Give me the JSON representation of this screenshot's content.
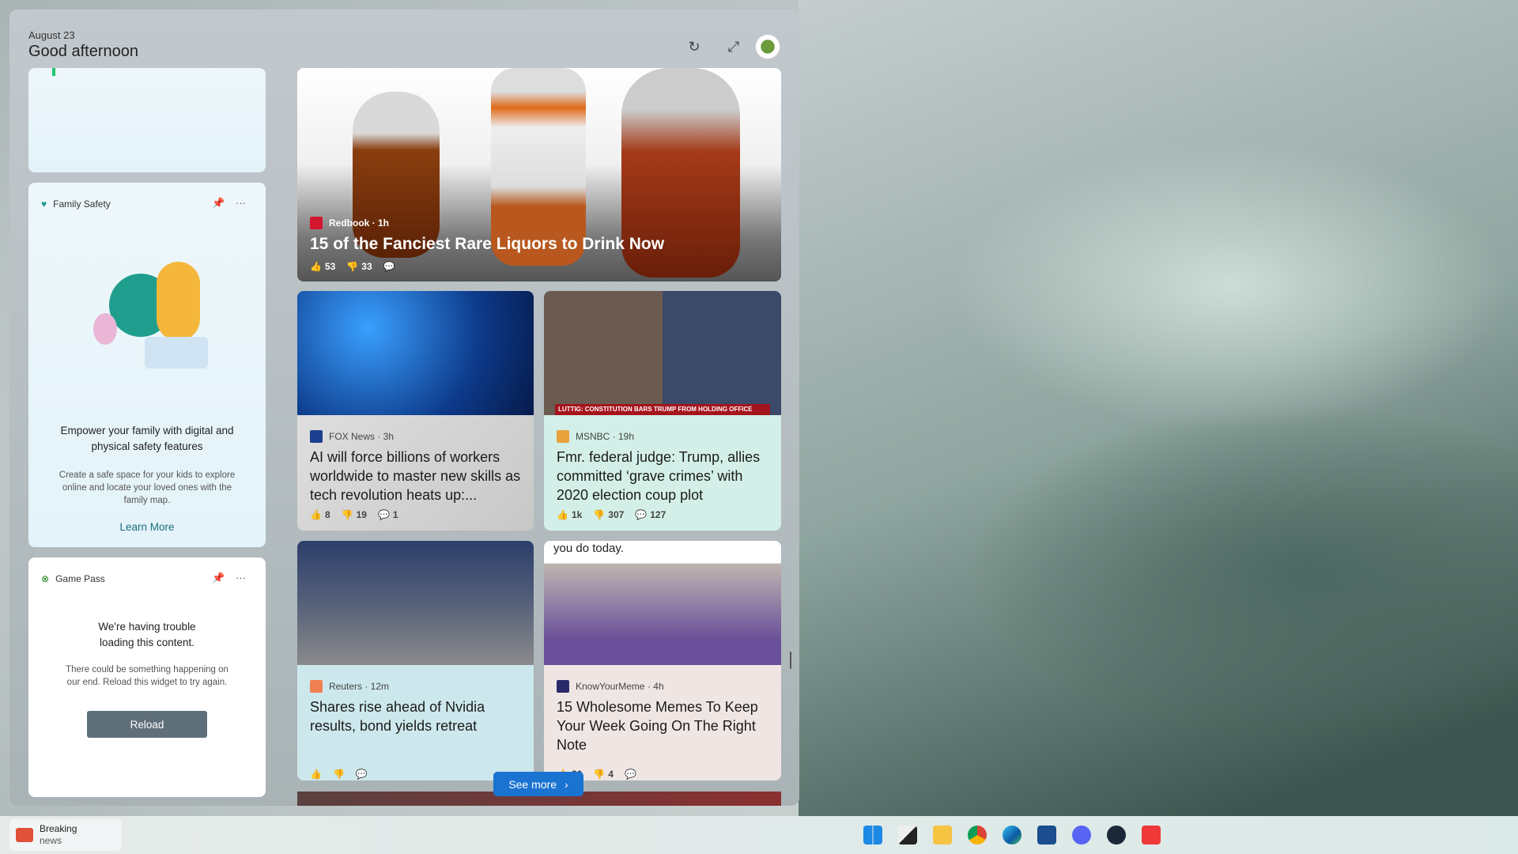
{
  "header": {
    "date": "August 23",
    "greeting": "Good afternoon",
    "refresh_icon": "refresh-icon",
    "expand_icon": "expand-icon"
  },
  "family_safety": {
    "title": "Family Safety",
    "heading": "Empower your family with digital and physical safety features",
    "body": "Create a safe space for your kids to explore online and locate your loved ones with the family map.",
    "link": "Learn More"
  },
  "game_pass": {
    "title": "Game Pass",
    "heading": "We're having trouble loading this content.",
    "body": "There could be something happening on our end. Reload this widget to try again.",
    "button": "Reload"
  },
  "hero": {
    "source": "Redbook · 1h",
    "title": "15 of the Fanciest Rare Liquors to Drink Now",
    "likes": "53",
    "dislikes": "33",
    "comments": ""
  },
  "news": [
    {
      "source": "FOX News · 3h",
      "title": "AI will force billions of workers worldwide to master new skills as tech revolution heats up:...",
      "likes": "8",
      "dislikes": "19",
      "comments": "1",
      "logo_color": "#1d3f8f"
    },
    {
      "source": "MSNBC · 19h",
      "title": "Fmr. federal judge: Trump, allies committed ‘grave crimes’ with 2020 election coup plot",
      "likes": "1k",
      "dislikes": "307",
      "comments": "127",
      "logo_color": "#e8a33c",
      "image_caption": "LUTTIG: CONSTITUTION BARS TRUMP FROM HOLDING OFFICE"
    },
    {
      "source": "Reuters · 12m",
      "title": "Shares rise ahead of Nvidia results, bond yields retreat",
      "likes": "",
      "dislikes": "",
      "comments": "",
      "logo_color": "#f08050"
    },
    {
      "source": "KnowYourMeme · 4h",
      "title": "15 Wholesome Memes To Keep Your Week Going On The Right Note",
      "likes": "20",
      "dislikes": "4",
      "comments": "",
      "logo_color": "#2a2a6a",
      "image_caption": "you do today."
    }
  ],
  "see_more": "See more",
  "taskbar": {
    "widget_title": "Breaking",
    "widget_sub": "news",
    "apps": [
      "start",
      "task-view",
      "file-explorer",
      "chrome",
      "edge",
      "store",
      "discord",
      "steam",
      "vivaldi"
    ]
  }
}
